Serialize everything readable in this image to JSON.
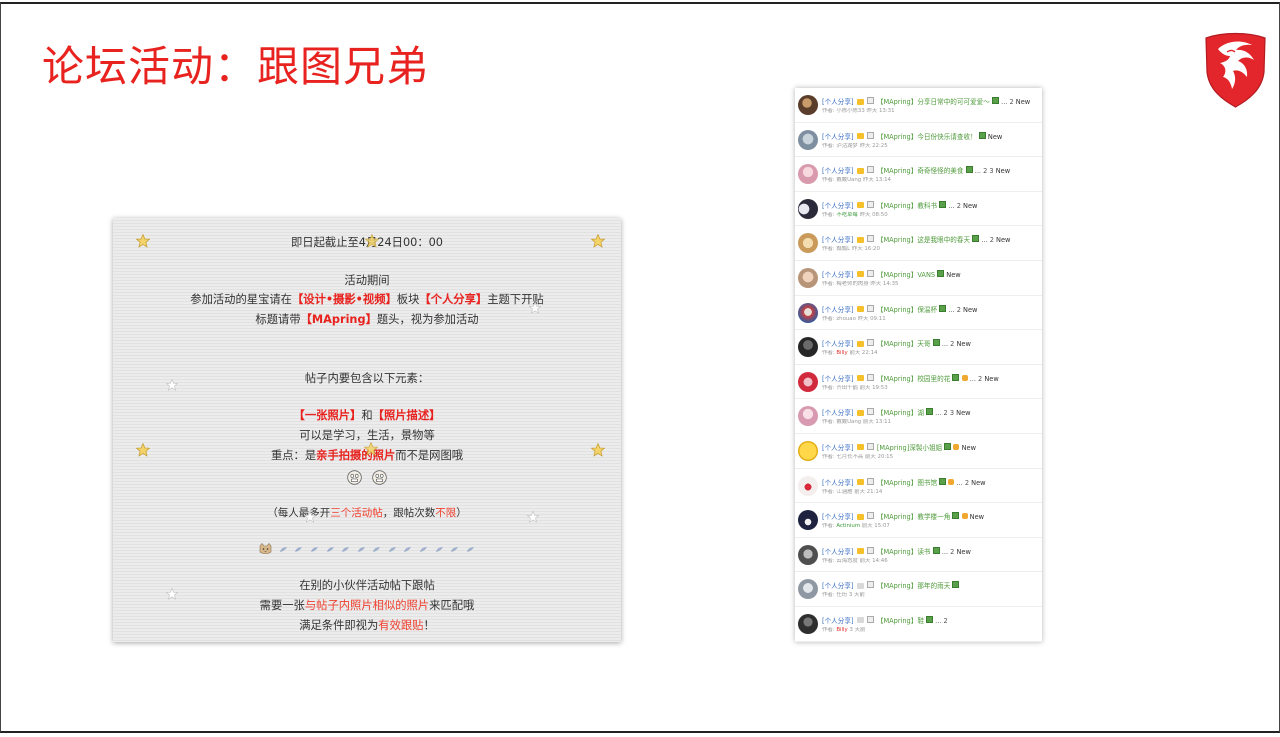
{
  "slide": {
    "title": "论坛活动：跟图兄弟",
    "logo_icon": "msi-dragon-shield-icon",
    "accent_color": "#e8231f"
  },
  "notice": {
    "deadline": "即日起截止至4月24日00：00",
    "period_heading": "活动期间",
    "join_line": [
      "参加活动的星宝请在",
      "【设计•摄影•视频】",
      "板块",
      "【个人分享】",
      "主题下开贴"
    ],
    "title_line": [
      "标题请带",
      "【MApring】",
      "题头，视为参加活动"
    ],
    "elements_heading": "帖子内要包含以下元素：",
    "elements_line": [
      "【一张照片】",
      "和",
      "【照片描述】"
    ],
    "subject_line": "可以是学习，生活，景物等",
    "key_line": [
      "重点：是",
      "亲手拍摄的照片",
      "而不是网图哦"
    ],
    "limit_line": [
      "（每人最多开",
      "三个活动帖",
      "，跟帖次数",
      "不限",
      "）"
    ],
    "reply_heading": "在别的小伙伴活动帖下跟帖",
    "reply_line": [
      "需要一张",
      "与帖子内照片相似的照片",
      "来匹配哦"
    ],
    "valid_line": [
      "满足条件即视为",
      "有效跟贴",
      "！"
    ]
  },
  "forum": {
    "author_prefix": "作者:",
    "threads": [
      {
        "category": "[个人分享]",
        "title": "【MApring】分享日常中的可可爱爱～",
        "pages": "... 2",
        "new": "New",
        "author": "小陈小陈33",
        "time": "昨天 13:31",
        "folder_icon": "folder-new-icon",
        "extra_icon": ""
      },
      {
        "category": "[个人分享]",
        "title": "【MApring】今日份快乐请查收！",
        "pages": "",
        "new": "New",
        "author": "泸沽湖梦",
        "time": "昨天 22:25",
        "folder_icon": "folder-new-icon",
        "extra_icon": ""
      },
      {
        "category": "[个人分享]",
        "title": "【MApring】奇奇怪怪的美食",
        "pages": "... 2 3",
        "new": "New",
        "author": "戴戴Uang",
        "time": "昨天 13:14",
        "folder_icon": "folder-new-icon",
        "extra_icon": ""
      },
      {
        "category": "[个人分享]",
        "title": "【MApring】教科书",
        "pages": "... 2",
        "new": "New",
        "author": "不吃草莓",
        "time": "昨天 08:50",
        "folder_icon": "folder-new-icon",
        "extra_icon": "",
        "author_color": "#3d9b3d"
      },
      {
        "category": "[个人分享]",
        "title": "【MApring】这是我眼中的春天",
        "pages": "... 2",
        "new": "New",
        "author": "瓢瓢L",
        "time": "昨天 16:20",
        "folder_icon": "folder-new-icon",
        "extra_icon": ""
      },
      {
        "category": "[个人分享]",
        "title": "【MApring】VANS",
        "pages": "",
        "new": "New",
        "author": "梅老师的肉身",
        "time": "昨天 14:35",
        "folder_icon": "folder-new-icon",
        "extra_icon": ""
      },
      {
        "category": "[个人分享]",
        "title": "【MApring】保温杯",
        "pages": "... 2",
        "new": "New",
        "author": "zhouao",
        "time": "昨天 09:11",
        "folder_icon": "folder-new-icon",
        "extra_icon": ""
      },
      {
        "category": "[个人分享]",
        "title": "【MApring】天哥",
        "pages": "... 2",
        "new": "New",
        "author": "Billy",
        "time": "前天 22:14",
        "folder_icon": "folder-new-icon",
        "extra_icon": "",
        "author_color": "#e0312b"
      },
      {
        "category": "[个人分享]",
        "title": "【MApring】校园里的花",
        "pages": "... 2",
        "new": "New",
        "author": "齐田千鹤",
        "time": "前天 19:53",
        "folder_icon": "folder-new-icon",
        "extra_icon": "thumbs-up-icon"
      },
      {
        "category": "[个人分享]",
        "title": "【MApring】湖",
        "pages": "... 2 3",
        "new": "New",
        "author": "戴戴Uang",
        "time": "前天 13:11",
        "folder_icon": "folder-new-icon",
        "extra_icon": ""
      },
      {
        "category": "[个人分享]",
        "title": "[MApring]深製小姐姐",
        "pages": "",
        "new": "New",
        "author": "七月长不高",
        "time": "前天 20:15",
        "folder_icon": "folder-new-icon",
        "extra_icon": "thumbs-up-icon"
      },
      {
        "category": "[个人分享]",
        "title": "【MApring】图书馆",
        "pages": "... 2",
        "new": "New",
        "author": "江涵雁",
        "time": "前天 21:14",
        "folder_icon": "folder-new-icon",
        "extra_icon": "thumbs-up-icon"
      },
      {
        "category": "[个人分享]",
        "title": "【MApring】教学楼一角",
        "pages": "",
        "new": "New",
        "author": "Actinium",
        "time": "前天 15:07",
        "folder_icon": "folder-new-icon",
        "extra_icon": "thumbs-up-icon",
        "author_color": "#3d9b3d"
      },
      {
        "category": "[个人分享]",
        "title": "【MApring】读书",
        "pages": "... 2",
        "new": "New",
        "author": "云海悠度",
        "time": "前天 14:46",
        "folder_icon": "folder-new-icon",
        "extra_icon": ""
      },
      {
        "category": "[个人分享]",
        "title": "【MApring】那年的雨天",
        "pages": "",
        "new": "",
        "author": "任珩",
        "time": "3 天前",
        "folder_icon": "folder-icon",
        "extra_icon": ""
      },
      {
        "category": "[个人分享]",
        "title": "【MApring】鞋",
        "pages": "... 2",
        "new": "",
        "author": "Billy",
        "time": "3 天前",
        "folder_icon": "folder-icon",
        "extra_icon": "",
        "author_color": "#e0312b"
      }
    ]
  }
}
